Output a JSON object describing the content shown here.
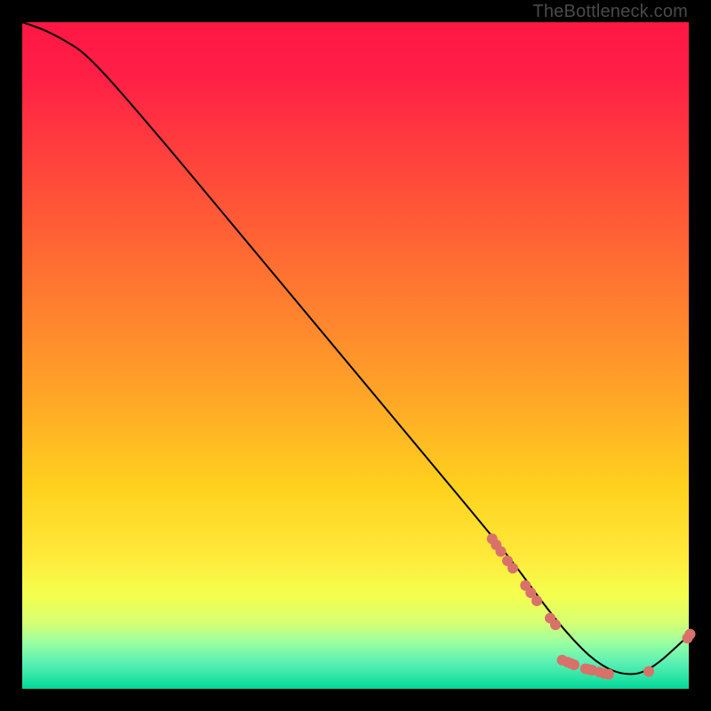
{
  "attribution": "TheBottleneck.com",
  "chart_data": {
    "type": "line",
    "title": "",
    "xlabel": "",
    "ylabel": "",
    "xlim": [
      0,
      100
    ],
    "ylim": [
      0,
      100
    ],
    "background_gradient": {
      "top": "#ff1744",
      "mid": "#ffd21e",
      "bottom": "#00d89b"
    },
    "series": [
      {
        "name": "bottleneck-curve",
        "color": "#000000",
        "x": [
          0,
          3,
          6,
          10,
          20,
          30,
          40,
          50,
          60,
          70,
          74,
          78,
          82,
          86,
          90,
          94,
          100
        ],
        "values": [
          100,
          99,
          97.5,
          95,
          83.5,
          71.5,
          59.5,
          47.5,
          35.5,
          23.5,
          18.5,
          13,
          8,
          4,
          2,
          2.5,
          8
        ]
      }
    ],
    "markers": [
      {
        "name": "highlighted-points",
        "color": "#d9716b",
        "radius_pct": 0.8,
        "points": [
          {
            "x": 70.5,
            "y": 22.5
          },
          {
            "x": 71.1,
            "y": 21.6
          },
          {
            "x": 71.8,
            "y": 20.6
          },
          {
            "x": 72.8,
            "y": 19.2
          },
          {
            "x": 73.6,
            "y": 18.1
          },
          {
            "x": 75.5,
            "y": 15.5
          },
          {
            "x": 76.3,
            "y": 14.4
          },
          {
            "x": 77.2,
            "y": 13.2
          },
          {
            "x": 79.2,
            "y": 10.6
          },
          {
            "x": 80.0,
            "y": 9.6
          },
          {
            "x": 81.0,
            "y": 4.3
          },
          {
            "x": 81.8,
            "y": 4.0
          },
          {
            "x": 82.3,
            "y": 3.8
          },
          {
            "x": 82.8,
            "y": 3.6
          },
          {
            "x": 84.5,
            "y": 3.0
          },
          {
            "x": 85.0,
            "y": 2.9
          },
          {
            "x": 85.5,
            "y": 2.8
          },
          {
            "x": 86.6,
            "y": 2.5
          },
          {
            "x": 87.3,
            "y": 2.3
          },
          {
            "x": 88.0,
            "y": 2.2
          },
          {
            "x": 94.0,
            "y": 2.6
          },
          {
            "x": 99.8,
            "y": 7.6
          },
          {
            "x": 100.2,
            "y": 8.2
          }
        ]
      }
    ]
  }
}
